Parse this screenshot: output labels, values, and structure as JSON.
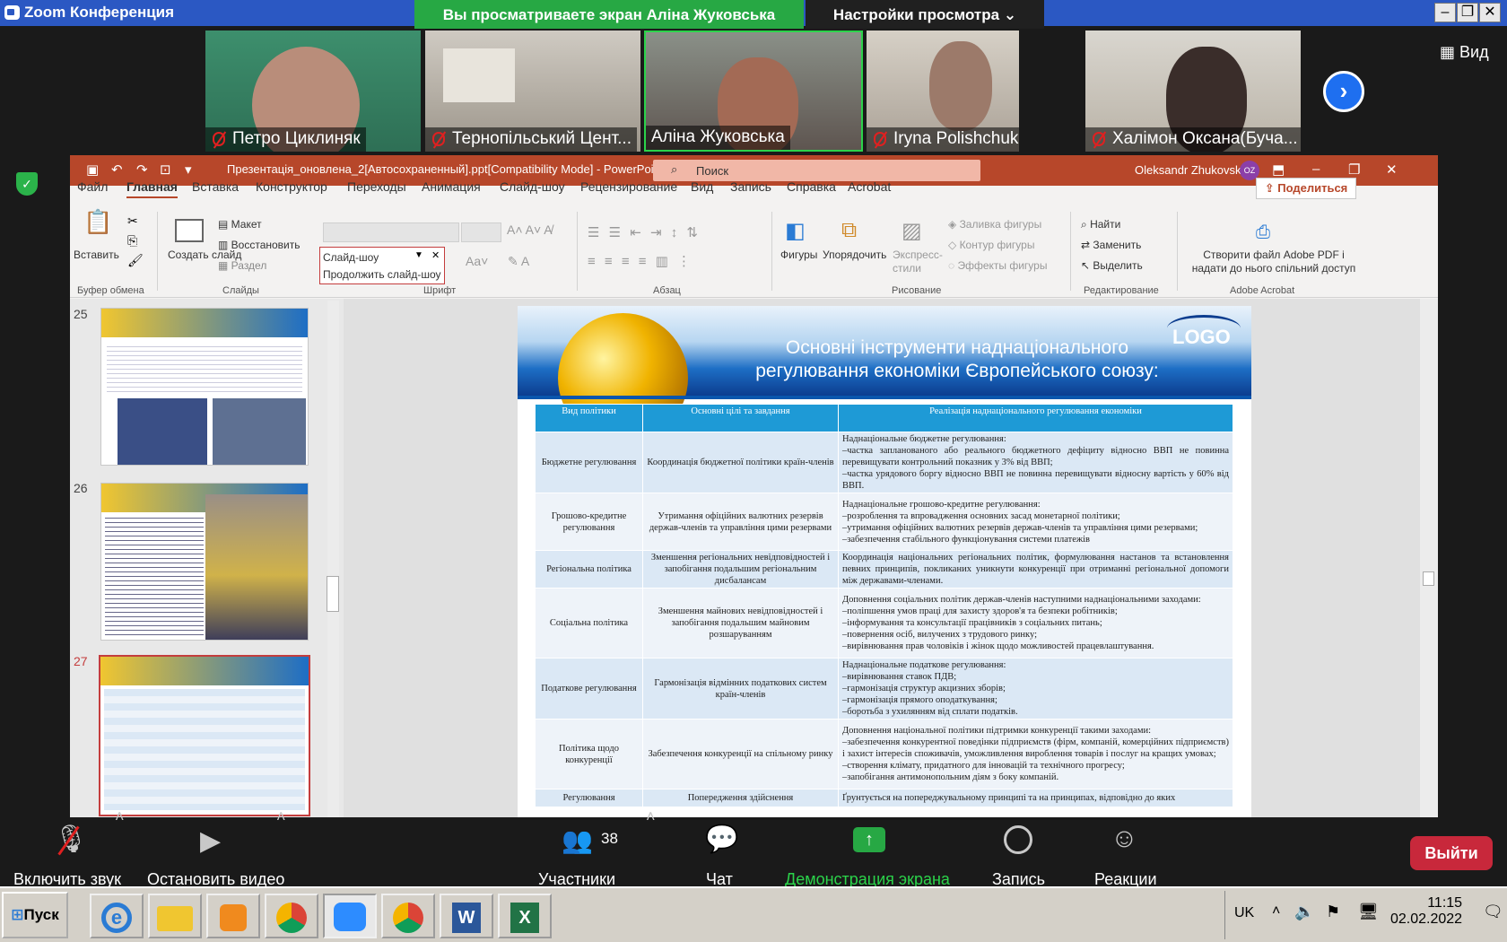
{
  "zoom": {
    "app_title": "Zoom Конференция",
    "share_banner": "Вы просматриваете экран Аліна Жуковська",
    "view_options": "Настройки просмотра",
    "gallery_label": "Вид",
    "participants": [
      {
        "name": "Петро Циклиняк"
      },
      {
        "name": "Тернопільський Цент..."
      },
      {
        "name": "Аліна Жуковська"
      },
      {
        "name": "Iryna Polishchuk"
      },
      {
        "name": "Халімон Оксана(Буча..."
      }
    ],
    "toolbar": {
      "unmute": "Включить звук",
      "stop_video": "Остановить видео",
      "participants": "Участники",
      "participant_count": "38",
      "chat": "Чат",
      "share_screen": "Демонстрация экрана",
      "record": "Запись",
      "reactions": "Реакции",
      "leave": "Выйти"
    },
    "colors": {
      "share_banner": "#27a844",
      "leave": "#c8283b",
      "title_bar": "#2b58c3"
    }
  },
  "ppt": {
    "filename": "Презентація_оновлена_2[Автосохраненный].ppt[Compatibility Mode]  -  PowerPoint",
    "search_placeholder": "Поиск",
    "user": "Oleksandr Zhukovsky",
    "user_initials": "OZ",
    "tabs": [
      "Файл",
      "Главная",
      "Вставка",
      "Конструктор",
      "Переходы",
      "Анимация",
      "Слайд-шоу",
      "Рецензирование",
      "Вид",
      "Запись",
      "Справка",
      "Acrobat"
    ],
    "active_tab": "Главная",
    "share": "Поделиться",
    "ribbon": {
      "paste": "Вставить",
      "create_slide": "Создать слайд",
      "layout": "Макет",
      "reset": "Восстановить",
      "section": "Раздел",
      "slideshow_dropdown": "Слайд-шоу",
      "continue_slideshow": "Продолжить слайд-шоу",
      "shapes": "Фигуры",
      "arrange": "Упорядочить",
      "quick_styles": "Экспресс-стили",
      "fill": "Заливка фигуры",
      "outline": "Контур фигуры",
      "effects": "Эффекты фигуры",
      "find": "Найти",
      "replace": "Заменить",
      "select": "Выделить",
      "adobe": "Створити файл Adobe PDF і надати до нього спільний доступ",
      "groups": [
        "Буфер обмена",
        "Слайды",
        "Шрифт",
        "Абзац",
        "Рисование",
        "Редактирование",
        "Adobe Acrobat"
      ]
    },
    "thumbnails": [
      {
        "num": "25"
      },
      {
        "num": "26"
      },
      {
        "num": "27"
      }
    ],
    "slide": {
      "title": "Основні інструменти наднаціонального регулювання економіки Європейського союзу:",
      "logo": "LOGO",
      "headers": [
        "Вид політики",
        "Основні цілі та завдання",
        "Реалізація наднаціонального регулювання економіки"
      ],
      "rows": [
        {
          "policy": "Бюджетне регулювання",
          "goal": "Координація бюджетної політики країн-членів",
          "impl": "Наднаціональне бюджетне регулювання:\n–частка запланованого або реального бюджетного дефіциту відносно ВВП не повинна перевищувати контрольний показник у 3% від ВВП;\n–частка урядового боргу відносно ВВП не повинна перевищувати відносну вартість у 60% від ВВП."
        },
        {
          "policy": "Грошово-кредитне регулювання",
          "goal": "Утримання офіційних валютних резервів держав-членів та управління цими резервами",
          "impl": "Наднаціональне грошово-кредитне регулювання:\n–розроблення та впровадження основних засад монетарної політики;\n–утримання офіційних валютних резервів держав-членів та управління цими резервами;\n–забезпечення стабільного функціонування системи платежів"
        },
        {
          "policy": "Регіональна політика",
          "goal": "Зменшення регіональних невідповідностей і запобігання подальшим регіональним дисбалансам",
          "impl": "Координація національних регіональних політик, формулювання настанов та встановлення певних принципів, покликаних уникнути конкуренції при отриманні регіональної допомоги між державами-членами."
        },
        {
          "policy": "Соціальна політика",
          "goal": "Зменшення майнових невідповідностей і запобігання подальшим майновим розшаруванням",
          "impl": "Доповнення соціальних політик держав-членів наступними наднаціональними заходами:\n–поліпшення умов праці для захисту здоров'я та безпеки робітників;\n–інформування та консультації працівників з соціальних питань;\n–повернення осіб, вилучених з трудового ринку;\n–вирівнювання прав чоловіків і жінок щодо можливостей працевлаштування."
        },
        {
          "policy": "Податкове регулювання",
          "goal": "Гармонізація відмінних податкових систем країн-членів",
          "impl": "Наднаціональне податкове регулювання:\n–вирівнювання ставок ПДВ;\n–гармонізація структур акцизних зборів;\n–гармонізація прямого оподаткування;\n–боротьба з ухилянням від сплати податків."
        },
        {
          "policy": "Політика щодо конкуренції",
          "goal": "Забезпечення конкуренції на спільному ринку",
          "impl": "Доповнення національної політики підтримки конкуренції такими заходами:\n–забезпечення конкурентної поведінки підприємств (фірм, компаній, комерційних підприємств) і захист інтересів споживачів, уможливлення вироблення товарів і послуг на кращих умовах;\n–створення клімату, придатного для інновацій та технічного прогресу;\n–запобігання антимонопольним діям з боку компаній."
        },
        {
          "policy": "Регулювання",
          "goal": "Попередження здійснення",
          "impl": "Ґрунтується на попереджувальному принципі та на принципах, відповідно до яких"
        }
      ]
    }
  },
  "taskbar": {
    "start": "Пуск",
    "lang": "UK",
    "time": "11:15",
    "date": "02.02.2022"
  }
}
